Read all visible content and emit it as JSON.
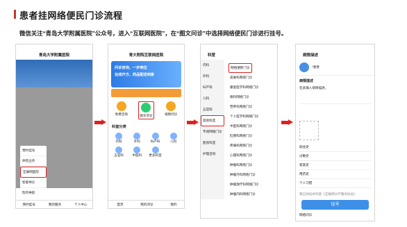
{
  "page": {
    "title": "患者挂网络便民门诊流程",
    "instruction": "微信关注“青岛大学附属医院”公众号，进入“互联网医院”，在“图文问诊”中选择网络便民门诊进行挂号。"
  },
  "phone1": {
    "app_title": "青岛大学附属医院",
    "menu": [
      "预约挂号",
      "体检业务",
      "互联网医院",
      "智能导诊",
      "院内导航"
    ],
    "bottom": [
      "预约挂号",
      "我的服务",
      "个人中心"
    ]
  },
  "phone2": {
    "app_title": "青大附院互联网医院",
    "banner": [
      "问诊咨询，一步到位",
      "在线开方，药品配送到家"
    ],
    "icons": [
      "免费咨询",
      "图文问诊",
      "视频问诊"
    ],
    "section": "科室分类",
    "depts": [
      "内科",
      "外科",
      "妇产科",
      "儿科",
      "五官科",
      "中医科",
      "更多科室"
    ],
    "bottom": [
      "首页",
      "我的问诊",
      "我的"
    ]
  },
  "phone3": {
    "app_title": "科室",
    "left": [
      "内科",
      "外科",
      "妇产科",
      "儿科",
      "五官科",
      "其他科室",
      "专病网络门诊",
      "医技科室",
      "护理咨询"
    ],
    "right": [
      "网络便民门诊",
      "皮肤科网络门诊",
      "康复医学科网络门诊",
      "眼科网络门诊",
      "营养科网络门诊",
      "个人医学科网络门诊",
      "中医科网络门诊",
      "肛肠科网络门诊",
      "疼痛科网络门诊",
      "心理科网络门诊",
      "肿瘤科网络门诊",
      "肿瘤外科网络门诊",
      "肿瘤放疗科网络门诊",
      "肿瘤内科网络门诊"
    ]
  },
  "phone4": {
    "app_title": "病情描述",
    "patient_label": "*患者",
    "section": "病情描述",
    "placeholder": "在此输入病情描述，",
    "fields": [
      "既往史",
      "过敏史",
      "家族史",
      "用药史",
      "个人习惯"
    ],
    "agree": "我已阅读并同意《互联网诊疗服务协议》",
    "submit": "挂号",
    "footer": "网络问诊"
  }
}
